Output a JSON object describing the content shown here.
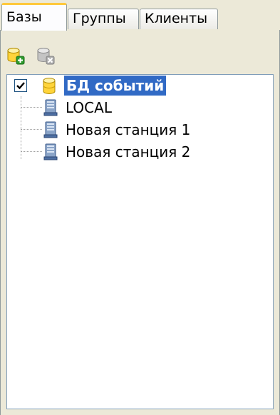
{
  "tabs": [
    {
      "label": "Базы",
      "active": true
    },
    {
      "label": "Группы",
      "active": false
    },
    {
      "label": "Клиенты",
      "active": false
    }
  ],
  "toolbar": {
    "add_icon": "database-add-icon",
    "remove_icon": "database-remove-icon"
  },
  "tree": {
    "root": {
      "label": "БД событий",
      "checked": true,
      "icon": "database-icon",
      "selected": true
    },
    "children": [
      {
        "label": "LOCAL",
        "icon": "computer-icon"
      },
      {
        "label": "Новая станция 1",
        "icon": "computer-icon"
      },
      {
        "label": "Новая станция 2",
        "icon": "computer-icon"
      }
    ]
  },
  "colors": {
    "selection": "#316ac5",
    "tab_highlight": "#ffc83c",
    "panel_bg": "#ece9d8"
  }
}
